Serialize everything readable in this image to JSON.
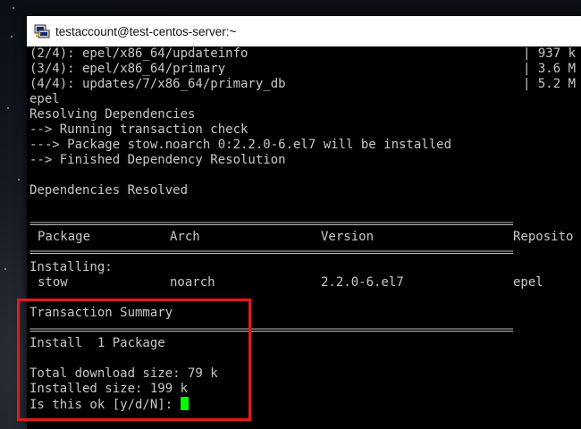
{
  "window": {
    "title": "testaccount@test-centos-server:~",
    "icon": "putty-terminal-icon"
  },
  "colors": {
    "terminal_bg": "#000000",
    "terminal_fg": "#c8c8c8",
    "cursor": "#00ff00",
    "highlight": "#e2191b"
  },
  "terminal": {
    "downloads": [
      {
        "name": "(2/4): epel/x86_64/updateinfo",
        "size": "| 937 k"
      },
      {
        "name": "(3/4): epel/x86_64/primary",
        "size": "| 3.6 M"
      },
      {
        "name": "(4/4): updates/7/x86_64/primary_db",
        "size": "| 5.2 M"
      }
    ],
    "lines": [
      "epel",
      "Resolving Dependencies",
      "--> Running transaction check",
      "---> Package stow.noarch 0:2.2.0-6.el7 will be installed",
      "--> Finished Dependency Resolution"
    ],
    "deps_resolved": "Dependencies Resolved",
    "table": {
      "headers": [
        "Package",
        "Arch",
        "Version",
        "Reposito"
      ],
      "section": "Installing:",
      "rows": [
        [
          "stow",
          "noarch",
          "2.2.0-6.el7",
          "epel"
        ]
      ]
    },
    "summary_title": "Transaction Summary",
    "install_line": "Install  1 Package",
    "total_download": "Total download size: 79 k",
    "installed_size": "Installed size: 199 k",
    "prompt": "Is this ok [y/d/N]: "
  }
}
